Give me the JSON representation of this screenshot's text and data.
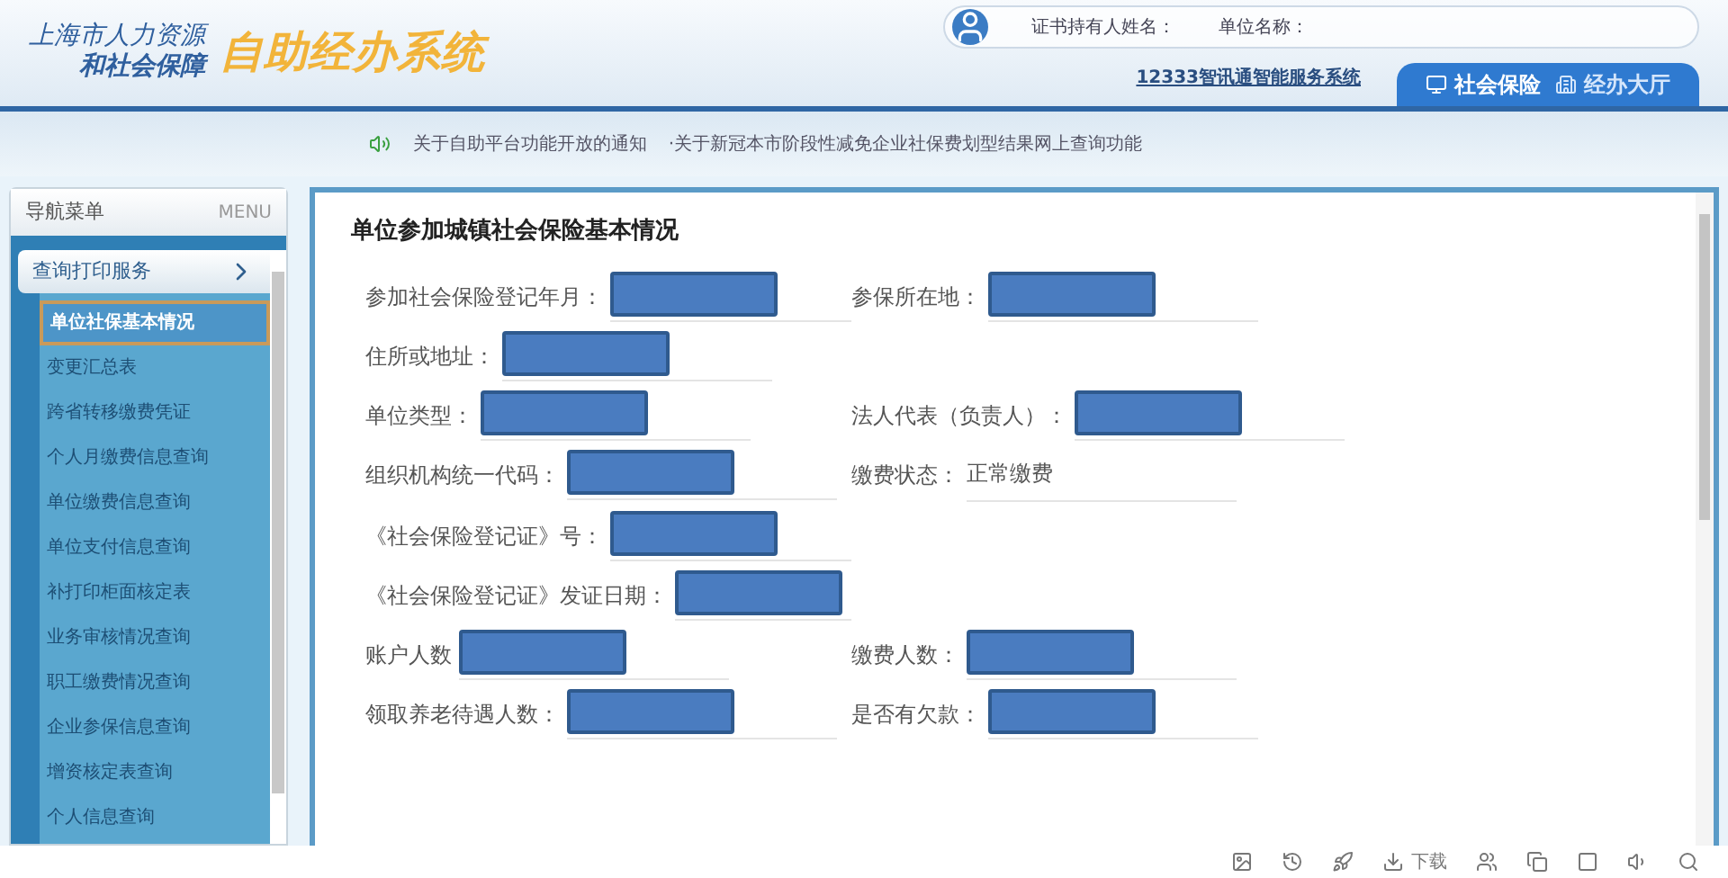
{
  "header": {
    "logo_line1": "上海市人力资源",
    "logo_line2": "和社会保障",
    "system_name": "自助经办系统",
    "holder_label": "证书持有人姓名：",
    "unit_label": "单位名称：",
    "service_link": "12333智讯通智能服务系统",
    "tabs": [
      {
        "label": "社会保险",
        "selected": true
      },
      {
        "label": "经办大厅",
        "selected": false
      }
    ]
  },
  "notices": [
    "关于自助平台功能开放的通知",
    "·关于新冠本市阶段性减免企业社保费划型结果网上查询功能"
  ],
  "sidebar": {
    "title": "导航菜单",
    "menu_label": "MENU",
    "group": {
      "label": "查询打印服务",
      "expanded": true
    },
    "items": [
      {
        "label": "单位社保基本情况",
        "selected": true
      },
      {
        "label": "变更汇总表",
        "selected": false
      },
      {
        "label": "跨省转移缴费凭证",
        "selected": false
      },
      {
        "label": "个人月缴费信息查询",
        "selected": false
      },
      {
        "label": "单位缴费信息查询",
        "selected": false
      },
      {
        "label": "单位支付信息查询",
        "selected": false
      },
      {
        "label": "补打印柜面核定表",
        "selected": false
      },
      {
        "label": "业务审核情况查询",
        "selected": false
      },
      {
        "label": "职工缴费情况查询",
        "selected": false
      },
      {
        "label": "企业参保信息查询",
        "selected": false
      },
      {
        "label": "增资核定表查询",
        "selected": false
      },
      {
        "label": "个人信息查询",
        "selected": false
      }
    ]
  },
  "content": {
    "title": "单位参加城镇社会保险基本情况",
    "rows": [
      [
        {
          "label": "参加社会保险登记年月：",
          "kind": "redacted"
        },
        {
          "label": "参保所在地：",
          "kind": "redacted"
        }
      ],
      [
        {
          "label": "住所或地址：",
          "kind": "redacted"
        }
      ],
      [
        {
          "label": "单位类型：",
          "kind": "redacted"
        },
        {
          "label": "法人代表（负责人）：",
          "kind": "redacted"
        }
      ],
      [
        {
          "label": "组织机构统一代码：",
          "kind": "redacted"
        },
        {
          "label": "缴费状态：",
          "kind": "text",
          "value": "正常缴费"
        }
      ],
      [
        {
          "label": "《社会保险登记证》号：",
          "kind": "redacted"
        }
      ],
      [
        {
          "label": "《社会保险登记证》发证日期：",
          "kind": "redacted"
        }
      ],
      [
        {
          "label": "账户人数",
          "kind": "redacted"
        },
        {
          "label": "缴费人数：",
          "kind": "redacted"
        }
      ],
      [
        {
          "label": "领取养老待遇人数：",
          "kind": "redacted"
        },
        {
          "label": "是否有欠款：",
          "kind": "redacted"
        }
      ]
    ]
  },
  "toolbar": {
    "download_label": "下载"
  }
}
